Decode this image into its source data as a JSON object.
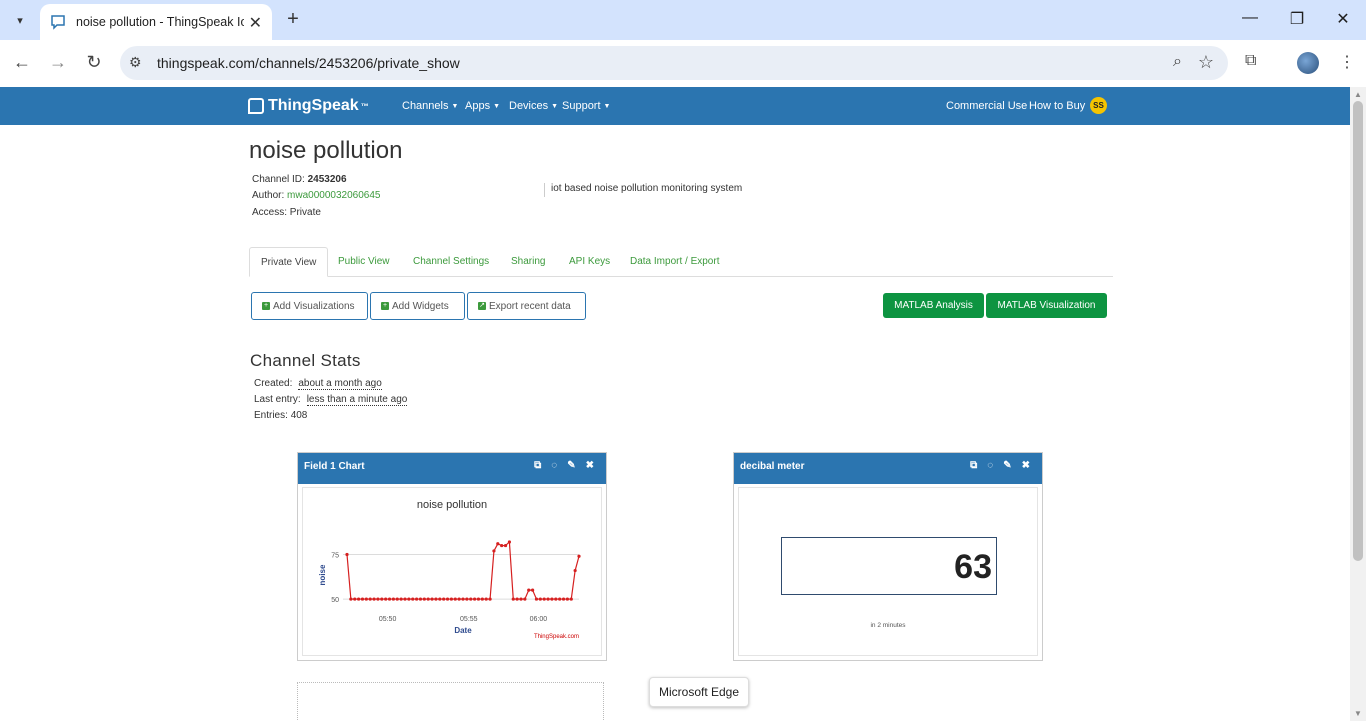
{
  "browser": {
    "tab_title": "noise pollution - ThingSpeak Io",
    "url": "thingspeak.com/channels/2453206/private_show",
    "new_tab_label": "+",
    "minimize": "—",
    "restore": "❐",
    "close": "✕"
  },
  "nav": {
    "logo": "ThingSpeak",
    "logo_tm": "™",
    "menus": [
      "Channels",
      "Apps",
      "Devices",
      "Support"
    ],
    "commercial_use": "Commercial Use",
    "how_to_buy": "How to Buy",
    "user_initials": "SS"
  },
  "channel": {
    "title": "noise pollution",
    "id_label": "Channel ID:",
    "id_value": "2453206",
    "author_label": "Author:",
    "author_value": "mwa0000032060645",
    "access_label": "Access:",
    "access_value": "Private",
    "description": "iot based noise pollution monitoring system"
  },
  "tabs": [
    "Private View",
    "Public View",
    "Channel Settings",
    "Sharing",
    "API Keys",
    "Data Import / Export"
  ],
  "actions": {
    "add_visualizations": "Add Visualizations",
    "add_widgets": "Add Widgets",
    "export_recent": "Export recent data",
    "matlab_analysis": "MATLAB Analysis",
    "matlab_visualization": "MATLAB Visualization"
  },
  "stats": {
    "heading": "Channel Stats",
    "created_label": "Created:",
    "created_value": "about a month ago",
    "last_entry_label": "Last entry:",
    "last_entry_value": "less than a minute ago",
    "entries_label": "Entries:",
    "entries_value": "408"
  },
  "widgets": {
    "chart_title": "Field 1 Chart",
    "meter_title": "decibal meter",
    "meter_value": "63",
    "meter_caption": "in 2 minutes"
  },
  "tooltip": "Microsoft Edge",
  "chart_data": {
    "type": "line",
    "title": "noise pollution",
    "xlabel": "Date",
    "ylabel": "noise",
    "credit": "ThingSpeak.com",
    "x_ticks": [
      "05:50",
      "05:55",
      "06:00"
    ],
    "y_ticks": [
      50,
      75
    ],
    "ylim": [
      45,
      82
    ],
    "color": "#d62020",
    "values": [
      75,
      50,
      50,
      50,
      50,
      50,
      50,
      50,
      50,
      50,
      50,
      50,
      50,
      50,
      50,
      50,
      50,
      50,
      50,
      50,
      50,
      50,
      50,
      50,
      50,
      50,
      50,
      50,
      50,
      50,
      50,
      50,
      50,
      50,
      50,
      50,
      50,
      50,
      50,
      50,
      50,
      50,
      50,
      50,
      50,
      50,
      50,
      50,
      50,
      50,
      50,
      50,
      50,
      50,
      50,
      50,
      50,
      50,
      50,
      50,
      50,
      50,
      50,
      50,
      50,
      50,
      50,
      50,
      50,
      50,
      50,
      50,
      50,
      50,
      50,
      50,
      50,
      50,
      50,
      50,
      50,
      50,
      50,
      50,
      50,
      50,
      50,
      50,
      50,
      50,
      50,
      50,
      50,
      50,
      50,
      50,
      50,
      50,
      50,
      50,
      50,
      50,
      50,
      50,
      50,
      50,
      50,
      50,
      50,
      50,
      50,
      50,
      50,
      50,
      50,
      50,
      50,
      50,
      50,
      50,
      50,
      50,
      50,
      50,
      50,
      50,
      50,
      50,
      50,
      50,
      50,
      50,
      50,
      50,
      50,
      50,
      50,
      50,
      50,
      50,
      50,
      50,
      50,
      50,
      50,
      50,
      50,
      50,
      50,
      50,
      50,
      50,
      50,
      50,
      50,
      50,
      50,
      50,
      50,
      50,
      50,
      50,
      50,
      50,
      50,
      50,
      50,
      50,
      50,
      50,
      50,
      50,
      50,
      50,
      50,
      50,
      50,
      50,
      50,
      50,
      50,
      50,
      50,
      50,
      50,
      50,
      50,
      50,
      50,
      50,
      50,
      50,
      50,
      50,
      50,
      50,
      50,
      50,
      50,
      50,
      50,
      50,
      50,
      50,
      50,
      50,
      50,
      50,
      50,
      50,
      50,
      50,
      50,
      50,
      50,
      50,
      50,
      50,
      50,
      50,
      50,
      50,
      50,
      50,
      50,
      50,
      50,
      50,
      50,
      50,
      50,
      50,
      50,
      50,
      50,
      50,
      50,
      50,
      50,
      50,
      50,
      50,
      50,
      50,
      50,
      50,
      50,
      50,
      50,
      50,
      50,
      50,
      50,
      50,
      50,
      50,
      50,
      50,
      50,
      50,
      50,
      50,
      50,
      50,
      50,
      50,
      50,
      50,
      50,
      50,
      50,
      50,
      50,
      50,
      50,
      50,
      50,
      50,
      50,
      50,
      50,
      50,
      50,
      50,
      50,
      50,
      50,
      50,
      50,
      50,
      50,
      50,
      50,
      50,
      50,
      50,
      50,
      50,
      50,
      50,
      50,
      50,
      50,
      50,
      50,
      50,
      50,
      50,
      50,
      50,
      50,
      50,
      50,
      50,
      50,
      50,
      50,
      50,
      50,
      50,
      50,
      50,
      50,
      50,
      50,
      50,
      50,
      50,
      50,
      50,
      50,
      50,
      50,
      50,
      50,
      50,
      50,
      50,
      50,
      50,
      50,
      50,
      50,
      50,
      50,
      50,
      50,
      50,
      50,
      50,
      50,
      50,
      50,
      50,
      50,
      50,
      50,
      50,
      50,
      50,
      50,
      50,
      50,
      50,
      50,
      50,
      50,
      50,
      50,
      50,
      50,
      50,
      50,
      50,
      50,
      50,
      50,
      50,
      50,
      50,
      50,
      50,
      50,
      50,
      50,
      50,
      50,
      50,
      50,
      50,
      50,
      50,
      50,
      50,
      50,
      50,
      50,
      50,
      50,
      50,
      50,
      50,
      50,
      50,
      50,
      50,
      50,
      50,
      50,
      50,
      50,
      50,
      50
    ],
    "series": [
      {
        "x": [
          0,
          1,
          2,
          3,
          4,
          5,
          6,
          7,
          8,
          9,
          10,
          11,
          12,
          13,
          14,
          15,
          16,
          17,
          18,
          19,
          20,
          21,
          22,
          23,
          24,
          25,
          26,
          27,
          28,
          29,
          30,
          31,
          32,
          33,
          34,
          35,
          36,
          37,
          38,
          39,
          40,
          41,
          42,
          43,
          44,
          45,
          46,
          47,
          48,
          49,
          50,
          51,
          52,
          53,
          54,
          55,
          56,
          57,
          58,
          59,
          60
        ],
        "values": [
          75,
          50,
          50,
          50,
          50,
          50,
          50,
          50,
          50,
          50,
          50,
          50,
          50,
          50,
          50,
          50,
          50,
          50,
          50,
          50,
          50,
          50,
          50,
          50,
          50,
          50,
          50,
          50,
          50,
          50,
          50,
          50,
          50,
          50,
          50,
          50,
          50,
          50,
          77,
          81,
          80,
          80,
          82,
          50,
          50,
          50,
          50,
          55,
          55,
          50,
          50,
          50,
          50,
          50,
          50,
          50,
          50,
          50,
          50,
          66,
          74
        ]
      }
    ]
  }
}
